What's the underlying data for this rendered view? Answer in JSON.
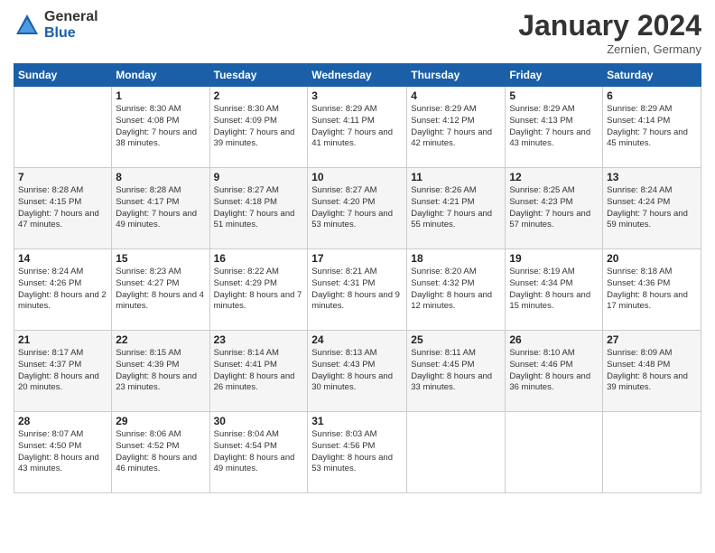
{
  "logo": {
    "general": "General",
    "blue": "Blue"
  },
  "header": {
    "month": "January 2024",
    "location": "Zernien, Germany"
  },
  "days_of_week": [
    "Sunday",
    "Monday",
    "Tuesday",
    "Wednesday",
    "Thursday",
    "Friday",
    "Saturday"
  ],
  "weeks": [
    [
      {
        "day": "",
        "sunrise": "",
        "sunset": "",
        "daylight": ""
      },
      {
        "day": "1",
        "sunrise": "Sunrise: 8:30 AM",
        "sunset": "Sunset: 4:08 PM",
        "daylight": "Daylight: 7 hours and 38 minutes."
      },
      {
        "day": "2",
        "sunrise": "Sunrise: 8:30 AM",
        "sunset": "Sunset: 4:09 PM",
        "daylight": "Daylight: 7 hours and 39 minutes."
      },
      {
        "day": "3",
        "sunrise": "Sunrise: 8:29 AM",
        "sunset": "Sunset: 4:11 PM",
        "daylight": "Daylight: 7 hours and 41 minutes."
      },
      {
        "day": "4",
        "sunrise": "Sunrise: 8:29 AM",
        "sunset": "Sunset: 4:12 PM",
        "daylight": "Daylight: 7 hours and 42 minutes."
      },
      {
        "day": "5",
        "sunrise": "Sunrise: 8:29 AM",
        "sunset": "Sunset: 4:13 PM",
        "daylight": "Daylight: 7 hours and 43 minutes."
      },
      {
        "day": "6",
        "sunrise": "Sunrise: 8:29 AM",
        "sunset": "Sunset: 4:14 PM",
        "daylight": "Daylight: 7 hours and 45 minutes."
      }
    ],
    [
      {
        "day": "7",
        "sunrise": "Sunrise: 8:28 AM",
        "sunset": "Sunset: 4:15 PM",
        "daylight": "Daylight: 7 hours and 47 minutes."
      },
      {
        "day": "8",
        "sunrise": "Sunrise: 8:28 AM",
        "sunset": "Sunset: 4:17 PM",
        "daylight": "Daylight: 7 hours and 49 minutes."
      },
      {
        "day": "9",
        "sunrise": "Sunrise: 8:27 AM",
        "sunset": "Sunset: 4:18 PM",
        "daylight": "Daylight: 7 hours and 51 minutes."
      },
      {
        "day": "10",
        "sunrise": "Sunrise: 8:27 AM",
        "sunset": "Sunset: 4:20 PM",
        "daylight": "Daylight: 7 hours and 53 minutes."
      },
      {
        "day": "11",
        "sunrise": "Sunrise: 8:26 AM",
        "sunset": "Sunset: 4:21 PM",
        "daylight": "Daylight: 7 hours and 55 minutes."
      },
      {
        "day": "12",
        "sunrise": "Sunrise: 8:25 AM",
        "sunset": "Sunset: 4:23 PM",
        "daylight": "Daylight: 7 hours and 57 minutes."
      },
      {
        "day": "13",
        "sunrise": "Sunrise: 8:24 AM",
        "sunset": "Sunset: 4:24 PM",
        "daylight": "Daylight: 7 hours and 59 minutes."
      }
    ],
    [
      {
        "day": "14",
        "sunrise": "Sunrise: 8:24 AM",
        "sunset": "Sunset: 4:26 PM",
        "daylight": "Daylight: 8 hours and 2 minutes."
      },
      {
        "day": "15",
        "sunrise": "Sunrise: 8:23 AM",
        "sunset": "Sunset: 4:27 PM",
        "daylight": "Daylight: 8 hours and 4 minutes."
      },
      {
        "day": "16",
        "sunrise": "Sunrise: 8:22 AM",
        "sunset": "Sunset: 4:29 PM",
        "daylight": "Daylight: 8 hours and 7 minutes."
      },
      {
        "day": "17",
        "sunrise": "Sunrise: 8:21 AM",
        "sunset": "Sunset: 4:31 PM",
        "daylight": "Daylight: 8 hours and 9 minutes."
      },
      {
        "day": "18",
        "sunrise": "Sunrise: 8:20 AM",
        "sunset": "Sunset: 4:32 PM",
        "daylight": "Daylight: 8 hours and 12 minutes."
      },
      {
        "day": "19",
        "sunrise": "Sunrise: 8:19 AM",
        "sunset": "Sunset: 4:34 PM",
        "daylight": "Daylight: 8 hours and 15 minutes."
      },
      {
        "day": "20",
        "sunrise": "Sunrise: 8:18 AM",
        "sunset": "Sunset: 4:36 PM",
        "daylight": "Daylight: 8 hours and 17 minutes."
      }
    ],
    [
      {
        "day": "21",
        "sunrise": "Sunrise: 8:17 AM",
        "sunset": "Sunset: 4:37 PM",
        "daylight": "Daylight: 8 hours and 20 minutes."
      },
      {
        "day": "22",
        "sunrise": "Sunrise: 8:15 AM",
        "sunset": "Sunset: 4:39 PM",
        "daylight": "Daylight: 8 hours and 23 minutes."
      },
      {
        "day": "23",
        "sunrise": "Sunrise: 8:14 AM",
        "sunset": "Sunset: 4:41 PM",
        "daylight": "Daylight: 8 hours and 26 minutes."
      },
      {
        "day": "24",
        "sunrise": "Sunrise: 8:13 AM",
        "sunset": "Sunset: 4:43 PM",
        "daylight": "Daylight: 8 hours and 30 minutes."
      },
      {
        "day": "25",
        "sunrise": "Sunrise: 8:11 AM",
        "sunset": "Sunset: 4:45 PM",
        "daylight": "Daylight: 8 hours and 33 minutes."
      },
      {
        "day": "26",
        "sunrise": "Sunrise: 8:10 AM",
        "sunset": "Sunset: 4:46 PM",
        "daylight": "Daylight: 8 hours and 36 minutes."
      },
      {
        "day": "27",
        "sunrise": "Sunrise: 8:09 AM",
        "sunset": "Sunset: 4:48 PM",
        "daylight": "Daylight: 8 hours and 39 minutes."
      }
    ],
    [
      {
        "day": "28",
        "sunrise": "Sunrise: 8:07 AM",
        "sunset": "Sunset: 4:50 PM",
        "daylight": "Daylight: 8 hours and 43 minutes."
      },
      {
        "day": "29",
        "sunrise": "Sunrise: 8:06 AM",
        "sunset": "Sunset: 4:52 PM",
        "daylight": "Daylight: 8 hours and 46 minutes."
      },
      {
        "day": "30",
        "sunrise": "Sunrise: 8:04 AM",
        "sunset": "Sunset: 4:54 PM",
        "daylight": "Daylight: 8 hours and 49 minutes."
      },
      {
        "day": "31",
        "sunrise": "Sunrise: 8:03 AM",
        "sunset": "Sunset: 4:56 PM",
        "daylight": "Daylight: 8 hours and 53 minutes."
      },
      {
        "day": "",
        "sunrise": "",
        "sunset": "",
        "daylight": ""
      },
      {
        "day": "",
        "sunrise": "",
        "sunset": "",
        "daylight": ""
      },
      {
        "day": "",
        "sunrise": "",
        "sunset": "",
        "daylight": ""
      }
    ]
  ]
}
